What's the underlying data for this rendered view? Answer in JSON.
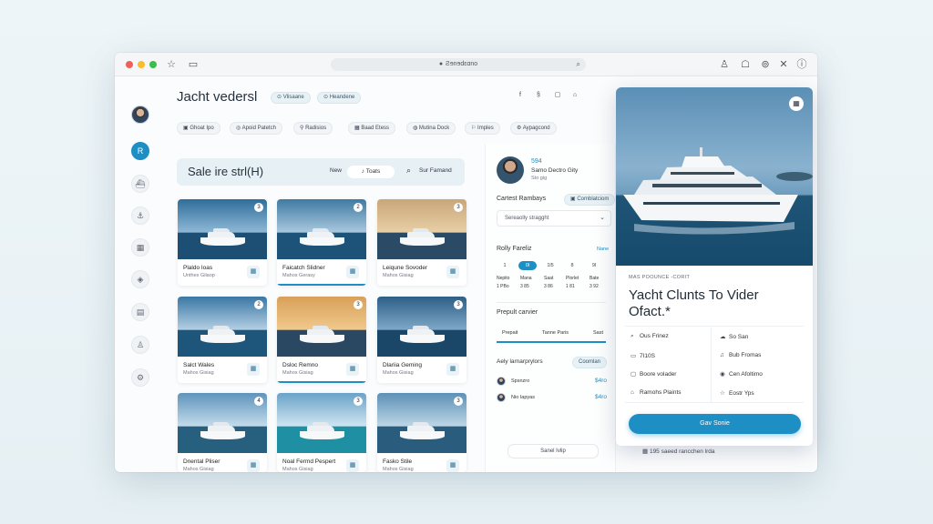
{
  "browser": {
    "url": "Ƨɘnɘdɛɑno",
    "colors": {
      "close": "#f25f58",
      "minimize": "#f9bd2e",
      "maximize": "#3ac04a"
    }
  },
  "app": {
    "title": "Jacht vedersl",
    "header_chips": [
      "Vlisaane",
      "Heandene"
    ],
    "filter_chips": [
      "Ghoat Ipo",
      "Apoid Patetch",
      "Radisios",
      "Baad Etess",
      "Mutina Dock",
      "Imples",
      "Aypagcond"
    ]
  },
  "search": {
    "title": "Sale ire strl(H)",
    "new_label": "New",
    "toggle_label": "Toats",
    "search_label": "Sur Famand"
  },
  "listings": [
    {
      "name": "Plaldo Ioas",
      "sub": "Unthes Gilaop",
      "num": "3"
    },
    {
      "name": "Faicatch Slidner",
      "sub": "Mahos Gerasy",
      "num": "2"
    },
    {
      "name": "Leiqune Sovoder",
      "sub": "Mahos Gisiag",
      "num": "3"
    },
    {
      "name": "Salct Wales",
      "sub": "Mahos Gisiag",
      "num": "2"
    },
    {
      "name": "Dsloc Remno",
      "sub": "Mahos Gisiag",
      "num": "3"
    },
    {
      "name": "Dlariia Geming",
      "sub": "Mahos Gisiag",
      "num": "3"
    },
    {
      "name": "Dnental Pliser",
      "sub": "Mahos Gisiag",
      "num": "4"
    },
    {
      "name": "Noal Fermd Pespert",
      "sub": "Mahos Gisiag",
      "num": "3"
    },
    {
      "name": "Fasko Stile",
      "sub": "Mahos Gisiag",
      "num": "3"
    }
  ],
  "profile": {
    "rating": "594",
    "name": "Samo Dectro Gity",
    "sub": "Sto gig",
    "section": "Cartest Rambays",
    "chip": "Comblatciom",
    "select": "Sereaolly stragght",
    "rates_title": "Rolly Fareliz",
    "rates_link": "Nane",
    "rate_buttons": [
      "1",
      "0l",
      "1l5",
      "8",
      "9l"
    ],
    "rate_rows1": [
      "Nepito",
      "Mana",
      "Saat",
      "Plorlet",
      "Bate"
    ],
    "rate_rows2": [
      "1 PBo",
      "3 85",
      "3 86",
      "1 81",
      "3 92"
    ],
    "service_title": "Prepult carvier",
    "service_cols": [
      "Prepait",
      "Tanne Paris",
      "Sast"
    ],
    "partners_title": "Aely larnarprylors",
    "partners_btn": "Coomlan",
    "partners": [
      {
        "name": "Spsnzro",
        "price": "$4ro"
      },
      {
        "name": "Nio Iapyas",
        "price": "$4ro"
      }
    ],
    "bottom_btn": "Sanel Ivlip"
  },
  "detail": {
    "kicker": "MAS POOUNCE -CORIT",
    "headline": "Yacht Clunts To Vider Ofact.*",
    "features": [
      {
        "icon": "pin-icon",
        "label": "Ous Frinez"
      },
      {
        "icon": "cloud-icon",
        "label": "So San"
      },
      {
        "icon": "calendar-icon",
        "label": "7I10S"
      },
      {
        "icon": "bell-icon",
        "label": "Bub Fromas"
      },
      {
        "icon": "monitor-icon",
        "label": "Boore volader"
      },
      {
        "icon": "location-icon",
        "label": "Cen Afoltimo"
      },
      {
        "icon": "home-icon",
        "label": "Ramohs Plaints"
      },
      {
        "icon": "star-icon",
        "label": "Eostr Yps"
      }
    ],
    "cta": "Gav Sonie"
  },
  "footer_note": "195 saeed rancchen lrda",
  "accent": "#1e8fc4"
}
